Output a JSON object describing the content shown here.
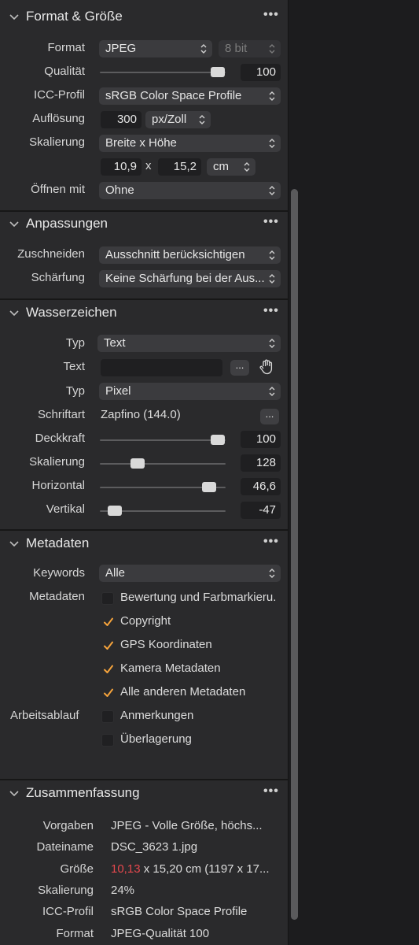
{
  "format_section": {
    "title": "Format & Größe",
    "more": "•••",
    "format_label": "Format",
    "format_value": "JPEG",
    "bitdepth_value": "8 bit",
    "quality_label": "Qualität",
    "quality_value": "100",
    "quality_fraction": 1.0,
    "icc_label": "ICC-Profil",
    "icc_value": "sRGB Color Space Profile",
    "resolution_label": "Auflösung",
    "resolution_value": "300",
    "resolution_unit": "px/Zoll",
    "scaling_label": "Skalierung",
    "scaling_value": "Breite x Höhe",
    "width_value": "10,9",
    "times": "x",
    "height_value": "15,2",
    "size_unit": "cm",
    "open_with_label": "Öffnen mit",
    "open_with_value": "Ohne"
  },
  "adjustments_section": {
    "title": "Anpassungen",
    "more": "•••",
    "crop_label": "Zuschneiden",
    "crop_value": "Ausschnitt berücksichtigen",
    "sharpen_label": "Schärfung",
    "sharpen_value": "Keine Schärfung bei der Aus..."
  },
  "watermark_section": {
    "title": "Wasserzeichen",
    "more": "•••",
    "type_label": "Typ",
    "type_value": "Text",
    "text_label": "Text",
    "text_value": "",
    "text_more": "...",
    "unit_label": "Typ",
    "unit_value": "Pixel",
    "font_label": "Schriftart",
    "font_value": "Zapfino (144.0)",
    "font_more": "...",
    "opacity_label": "Deckkraft",
    "opacity_value": "100",
    "scale_label": "Skalierung",
    "scale_value": "128",
    "horizontal_label": "Horizontal",
    "horizontal_value": "46,6",
    "vertical_label": "Vertikal",
    "vertical_value": "-47"
  },
  "metadata_section": {
    "title": "Metadaten",
    "more": "•••",
    "keywords_label": "Keywords",
    "keywords_value": "Alle",
    "metadata_label": "Metadaten",
    "workflow_label": "Arbeitsablauf",
    "items": [
      {
        "label": "Bewertung und Farbmarkieru.",
        "checked": false
      },
      {
        "label": "Copyright",
        "checked": true
      },
      {
        "label": "GPS Koordinaten",
        "checked": true
      },
      {
        "label": "Kamera Metadaten",
        "checked": true
      },
      {
        "label": "Alle anderen Metadaten",
        "checked": true
      },
      {
        "label": "Anmerkungen",
        "checked": false
      },
      {
        "label": "Überlagerung",
        "checked": false
      }
    ]
  },
  "summary_section": {
    "title": "Zusammenfassung",
    "more": "•••",
    "preset_label": "Vorgaben",
    "preset_value": "JPEG - Volle Größe, höchs...",
    "filename_label": "Dateiname",
    "filename_value": "DSC_3623 1.jpg",
    "size_label": "Größe",
    "size_value_red": "10,13",
    "size_value_rest": " x 15,20 cm (1197 x 17...",
    "scaling_label": "Skalierung",
    "scaling_value": "24%",
    "icc_label": "ICC-Profil",
    "icc_value": "sRGB Color Space Profile",
    "format_label": "Format",
    "format_value": "JPEG-Qualität 100"
  },
  "colors": {
    "panel": "#2a2a2c",
    "control": "#3b3b3e",
    "check": "#f5a33c",
    "warning": "#e5484d"
  }
}
